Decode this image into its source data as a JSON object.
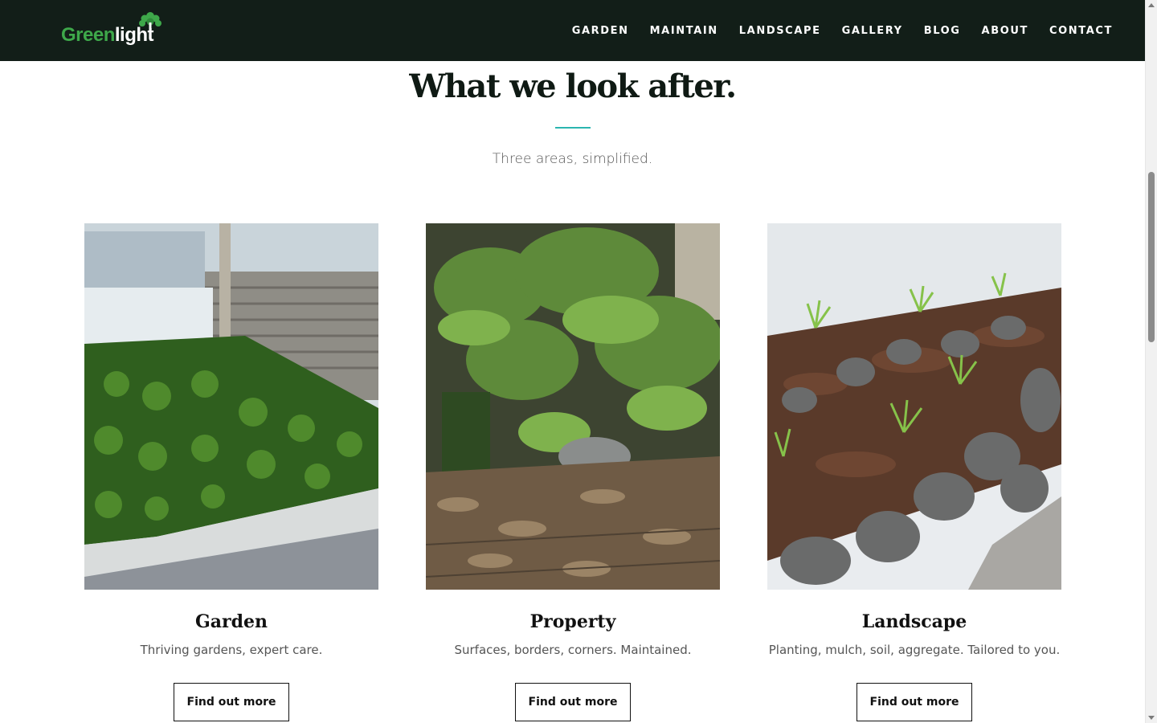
{
  "brand": {
    "part1": "Green",
    "part2": "light"
  },
  "nav": [
    "GARDEN",
    "MAINTAIN",
    "LANDSCAPE",
    "GALLERY",
    "BLOG",
    "ABOUT",
    "CONTACT"
  ],
  "section": {
    "title": "What we look after.",
    "subtitle": "Three areas, simplified."
  },
  "cards": [
    {
      "title": "Garden",
      "description": "Thriving gardens, expert care.",
      "button": "Find out more"
    },
    {
      "title": "Property",
      "description": "Surfaces, borders, corners. Maintained.",
      "button": "Find out more"
    },
    {
      "title": "Landscape",
      "description": "Planting, mulch, soil, aggregate. Tailored to you.",
      "button": "Find out more"
    }
  ],
  "colors": {
    "header_bg": "#121e18",
    "brand_green": "#3ea84a",
    "divider_teal": "#2bb5b0"
  }
}
